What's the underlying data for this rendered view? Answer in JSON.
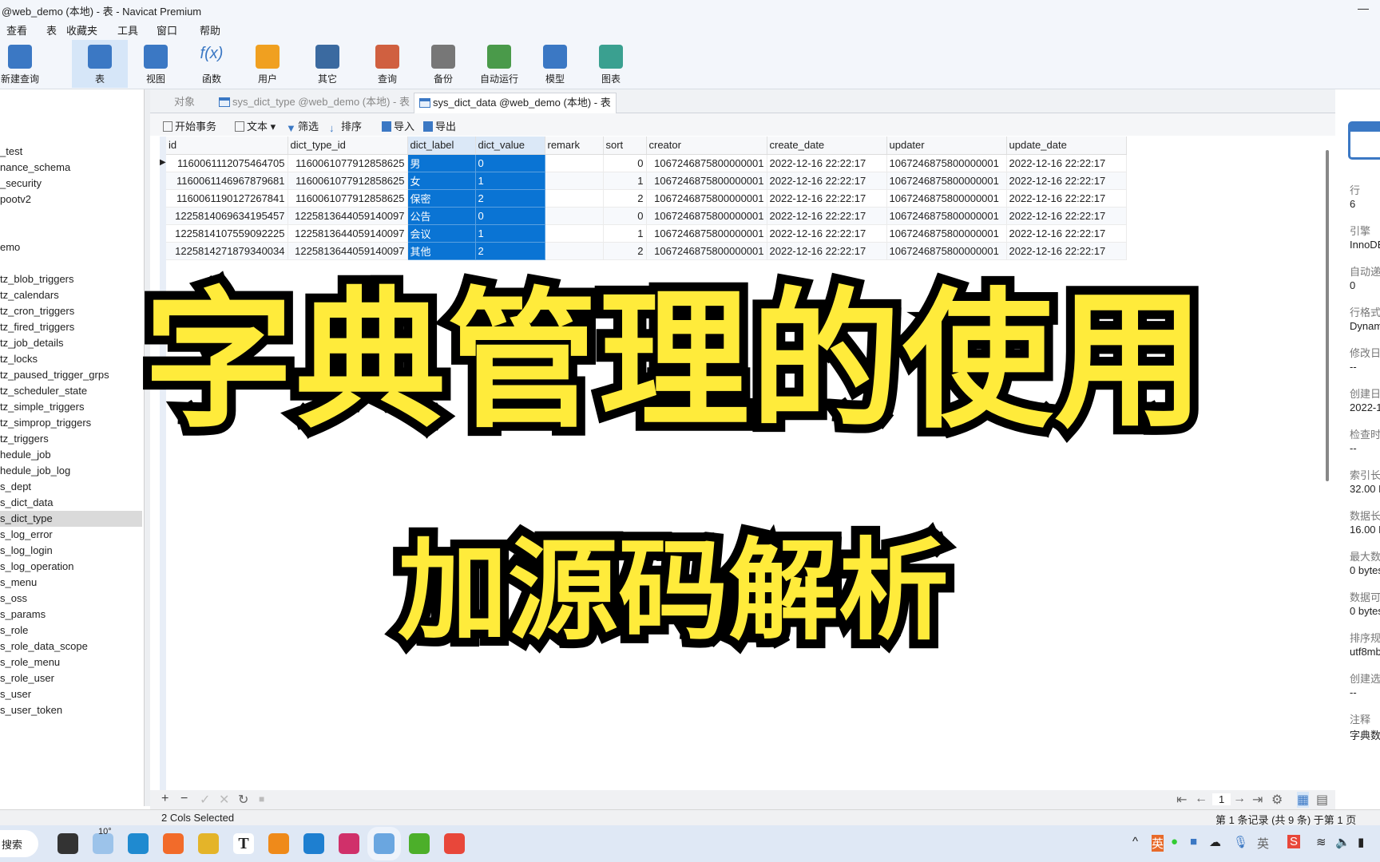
{
  "window": {
    "title": "@web_demo (本地) - 表 - Navicat Premium",
    "minimize": "—"
  },
  "menu": [
    "查看",
    "表",
    "收藏夹",
    "工具",
    "窗口",
    "帮助"
  ],
  "toolbar": [
    {
      "label": "新建查询",
      "icon": "new-query-icon",
      "color": "#3b78c4"
    },
    {
      "label": "表",
      "icon": "table-icon",
      "color": "#3b78c4",
      "active": true
    },
    {
      "label": "视图",
      "icon": "view-icon",
      "color": "#3b78c4"
    },
    {
      "label": "函数",
      "icon": "function-icon",
      "color": "#3b78c4"
    },
    {
      "label": "用户",
      "icon": "user-icon",
      "color": "#f0a020"
    },
    {
      "label": "其它",
      "icon": "tools-icon",
      "color": "#3b6aa0"
    },
    {
      "label": "查询",
      "icon": "query-icon",
      "color": "#d06040"
    },
    {
      "label": "备份",
      "icon": "backup-icon",
      "color": "#777"
    },
    {
      "label": "自动运行",
      "icon": "automation-icon",
      "color": "#4a9a4a"
    },
    {
      "label": "模型",
      "icon": "model-icon",
      "color": "#3b78c4"
    },
    {
      "label": "图表",
      "icon": "chart-icon",
      "color": "#3aa090"
    }
  ],
  "toolbar_fx": "f(x)",
  "sidebar": {
    "items": [
      "_test",
      "nance_schema",
      "_security",
      "pootv2",
      "",
      "",
      "emo",
      "",
      "tz_blob_triggers",
      "tz_calendars",
      "tz_cron_triggers",
      "tz_fired_triggers",
      "tz_job_details",
      "tz_locks",
      "tz_paused_trigger_grps",
      "tz_scheduler_state",
      "tz_simple_triggers",
      "tz_simprop_triggers",
      "tz_triggers",
      "hedule_job",
      "hedule_job_log",
      "s_dept",
      "s_dict_data",
      "s_dict_type",
      "s_log_error",
      "s_log_login",
      "s_log_operation",
      "s_menu",
      "s_oss",
      "s_params",
      "s_role",
      "s_role_data_scope",
      "s_role_menu",
      "s_role_user",
      "s_user",
      "s_user_token"
    ],
    "selected": "s_dict_type"
  },
  "tabs": [
    {
      "label": "对象"
    },
    {
      "label": "sys_dict_type @web_demo (本地) - 表"
    },
    {
      "label": "sys_dict_data @web_demo (本地) - 表",
      "active": true
    }
  ],
  "data_toolbar": {
    "begin": "开始事务",
    "text": "文本",
    "filter": "筛选",
    "sort": "排序",
    "import": "导入",
    "export": "导出"
  },
  "grid": {
    "columns": [
      "id",
      "dict_type_id",
      "dict_label",
      "dict_value",
      "remark",
      "sort",
      "creator",
      "create_date",
      "updater",
      "update_date"
    ],
    "selected_columns": [
      "dict_label",
      "dict_value"
    ],
    "rows": [
      [
        "1160061112075464705",
        "1160061077912858625",
        "男",
        "0",
        "",
        "0",
        "1067246875800000001",
        "2022-12-16 22:22:17",
        "1067246875800000001",
        "2022-12-16 22:22:17"
      ],
      [
        "1160061146967879681",
        "1160061077912858625",
        "女",
        "1",
        "",
        "1",
        "1067246875800000001",
        "2022-12-16 22:22:17",
        "1067246875800000001",
        "2022-12-16 22:22:17"
      ],
      [
        "1160061190127267841",
        "1160061077912858625",
        "保密",
        "2",
        "",
        "2",
        "1067246875800000001",
        "2022-12-16 22:22:17",
        "1067246875800000001",
        "2022-12-16 22:22:17"
      ],
      [
        "1225814069634195457",
        "1225813644059140097",
        "公告",
        "0",
        "",
        "0",
        "1067246875800000001",
        "2022-12-16 22:22:17",
        "1067246875800000001",
        "2022-12-16 22:22:17"
      ],
      [
        "1225814107559092225",
        "1225813644059140097",
        "会议",
        "1",
        "",
        "1",
        "1067246875800000001",
        "2022-12-16 22:22:17",
        "1067246875800000001",
        "2022-12-16 22:22:17"
      ],
      [
        "1225814271879340034",
        "1225813644059140097",
        "其他",
        "2",
        "",
        "2",
        "1067246875800000001",
        "2022-12-16 22:22:17",
        "1067246875800000001",
        "2022-12-16 22:22:17"
      ]
    ]
  },
  "overlay": {
    "title": "字典管理的使用",
    "subtitle": "加源码解析",
    "color": "#ffeb3b"
  },
  "bottom": {
    "add": "+",
    "remove": "−",
    "apply": "✓",
    "cancel": "✕",
    "refresh": "↻",
    "stop": "■",
    "page": "1",
    "cols_selected": "2 Cols Selected",
    "records": "第 1 条记录 (共 9 条) 于第 1 页"
  },
  "info": [
    {
      "k": "行",
      "v": "6"
    },
    {
      "k": "引擎",
      "v": "InnoDB"
    },
    {
      "k": "自动递",
      "v": "0"
    },
    {
      "k": "行格式",
      "v": "Dynam"
    },
    {
      "k": "修改日",
      "v": "--"
    },
    {
      "k": "创建日",
      "v": "2022-1"
    },
    {
      "k": "检查时",
      "v": "--"
    },
    {
      "k": "索引长",
      "v": "32.00 K"
    },
    {
      "k": "数据长",
      "v": "16.00 K"
    },
    {
      "k": "最大数",
      "v": "0 bytes"
    },
    {
      "k": "数据可",
      "v": "0 bytes"
    },
    {
      "k": "排序规",
      "v": "utf8mb"
    },
    {
      "k": "创建选",
      "v": "--"
    },
    {
      "k": "注释",
      "v": "字典数"
    }
  ],
  "taskbar": {
    "search": "搜索",
    "weather": "10°",
    "apps": [
      {
        "name": "explorer",
        "color": "#333"
      },
      {
        "name": "weather",
        "color": "#9cc3ea"
      },
      {
        "name": "edge",
        "color": "#1f8ad0"
      },
      {
        "name": "firefox",
        "color": "#f26b2a"
      },
      {
        "name": "chrome",
        "color": "#e4b429"
      },
      {
        "name": "typora",
        "color": "#fff"
      },
      {
        "name": "sublime",
        "color": "#ef8a1a"
      },
      {
        "name": "vscode",
        "color": "#1e7fd0"
      },
      {
        "name": "intellij",
        "color": "#d0306a"
      },
      {
        "name": "navicat",
        "color": "#6aa6e0"
      },
      {
        "name": "camtasia-green",
        "color": "#4caf2a"
      },
      {
        "name": "camtasia-red",
        "color": "#e8473a"
      }
    ],
    "typora_glyph": "T",
    "tray": {
      "chevron": "^",
      "ime1": "英",
      "ime2": "英"
    }
  }
}
